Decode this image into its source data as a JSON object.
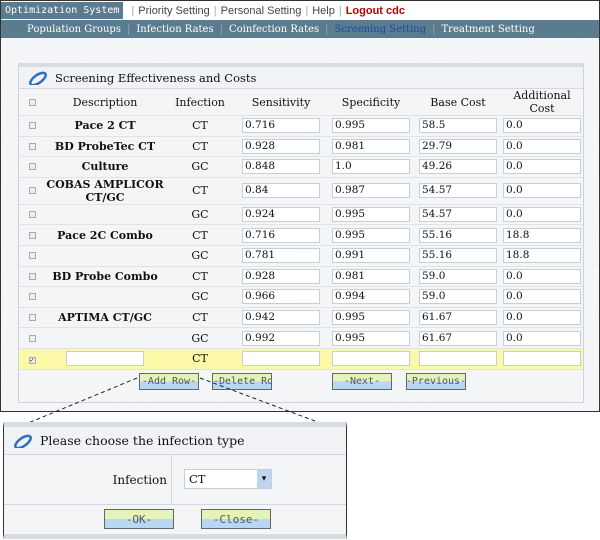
{
  "topnav": {
    "system": "Optimization System",
    "links": [
      "Priority Setting",
      "Personal Setting",
      "Help"
    ],
    "logout": "Logout cdc"
  },
  "subnav": {
    "items": [
      "Population Groups",
      "Infection Rates",
      "Coinfection Rates",
      "Screening Setting",
      "Treatment Setting"
    ],
    "active": "Screening Setting"
  },
  "panel": {
    "title": "Screening Effectiveness and Costs",
    "columns": [
      "Description",
      "Infection",
      "Sensitivity",
      "Specificity",
      "Base Cost",
      "Additional Cost"
    ],
    "rows": [
      {
        "description": "Pace 2 CT",
        "infection": "CT",
        "sensitivity": "0.716",
        "specificity": "0.995",
        "base_cost": "58.5",
        "additional_cost": "0.0"
      },
      {
        "description": "BD ProbeTec CT",
        "infection": "CT",
        "sensitivity": "0.928",
        "specificity": "0.981",
        "base_cost": "29.79",
        "additional_cost": "0.0"
      },
      {
        "description": "Culture",
        "infection": "GC",
        "sensitivity": "0.848",
        "specificity": "1.0",
        "base_cost": "49.26",
        "additional_cost": "0.0"
      },
      {
        "description": "COBAS AMPLICOR CT/GC",
        "infection": "CT",
        "sensitivity": "0.84",
        "specificity": "0.987",
        "base_cost": "54.57",
        "additional_cost": "0.0"
      },
      {
        "description": "",
        "infection": "GC",
        "sensitivity": "0.924",
        "specificity": "0.995",
        "base_cost": "54.57",
        "additional_cost": "0.0"
      },
      {
        "description": "Pace 2C Combo",
        "infection": "CT",
        "sensitivity": "0.716",
        "specificity": "0.995",
        "base_cost": "55.16",
        "additional_cost": "18.8"
      },
      {
        "description": "",
        "infection": "GC",
        "sensitivity": "0.781",
        "specificity": "0.991",
        "base_cost": "55.16",
        "additional_cost": "18.8"
      },
      {
        "description": "BD Probe Combo",
        "infection": "CT",
        "sensitivity": "0.928",
        "specificity": "0.981",
        "base_cost": "59.0",
        "additional_cost": "0.0"
      },
      {
        "description": "",
        "infection": "GC",
        "sensitivity": "0.966",
        "specificity": "0.994",
        "base_cost": "59.0",
        "additional_cost": "0.0"
      },
      {
        "description": "APTIMA CT/GC",
        "infection": "CT",
        "sensitivity": "0.942",
        "specificity": "0.995",
        "base_cost": "61.67",
        "additional_cost": "0.0"
      },
      {
        "description": "",
        "infection": "GC",
        "sensitivity": "0.992",
        "specificity": "0.995",
        "base_cost": "61.67",
        "additional_cost": "0.0"
      }
    ],
    "new_row": {
      "infection": "CT",
      "checked": true
    },
    "buttons": {
      "add": "-Add Row-",
      "delete": "-Delete Row-",
      "next": "-Next-",
      "previous": "-Previous-"
    }
  },
  "popup": {
    "title": "Please choose the infection type",
    "label": "Infection",
    "selected": "CT",
    "ok": "-OK-",
    "close": "-Close-"
  },
  "colors": {
    "nav": "#5b7b8e",
    "active_tab": "#1a4fa0",
    "logout": "#bb0000",
    "new_row": "#fbf8a8"
  }
}
